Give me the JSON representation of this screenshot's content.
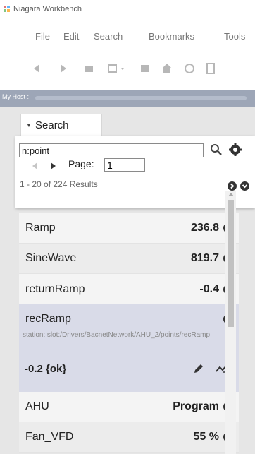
{
  "window": {
    "title": "Niagara Workbench"
  },
  "menu": {
    "items": [
      "File",
      "Edit",
      "Search",
      "Bookmarks",
      "Tools"
    ]
  },
  "toolbar": {
    "icons": [
      "back-arrow-icon",
      "forward-arrow-icon",
      "folder-icon",
      "view-dropdown-icon",
      "save-icon",
      "home-icon",
      "refresh-icon",
      "document-icon"
    ]
  },
  "host": {
    "label": "My Host :"
  },
  "search": {
    "tab_label": "Search",
    "query": "n:point",
    "page_label": "Page:",
    "page_value": "1",
    "results_text": "1 - 20 of 224 Results"
  },
  "list": {
    "rows": [
      {
        "name": "Ramp",
        "value": "236.8"
      },
      {
        "name": "SineWave",
        "value": "819.7"
      },
      {
        "name": "returnRamp",
        "value": "-0.4"
      }
    ],
    "expanded": {
      "name": "recRamp",
      "path": "station:|slot:/Drivers/BacnetNetwork/AHU_2/points/recRamp",
      "status": "-0.2 {ok}"
    },
    "rows_after": [
      {
        "name": "AHU",
        "value": "Program"
      },
      {
        "name": "Fan_VFD",
        "value": "55 %"
      }
    ]
  },
  "colors": {
    "host_bar": "#9da6b7",
    "pane_bg": "#e6e6e6",
    "selected_row": "#d9dbe8"
  }
}
